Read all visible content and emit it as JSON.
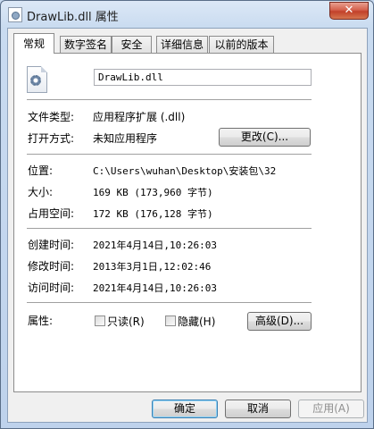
{
  "window": {
    "title": "DrawLib.dll 属性",
    "close_label": "✕"
  },
  "tabs": [
    {
      "label": "常规",
      "active": true
    },
    {
      "label": "数字签名",
      "active": false
    },
    {
      "label": "安全",
      "active": false
    },
    {
      "label": "详细信息",
      "active": false
    },
    {
      "label": "以前的版本",
      "active": false
    }
  ],
  "general": {
    "file_name": "DrawLib.dll",
    "file_type_label": "文件类型:",
    "file_type_value": "应用程序扩展 (.dll)",
    "open_with_label": "打开方式:",
    "open_with_value": "未知应用程序",
    "change_button": "更改(C)...",
    "location_label": "位置:",
    "location_value": "C:\\Users\\wuhan\\Desktop\\安装包\\32",
    "size_label": "大小:",
    "size_value": "169 KB (173,960 字节)",
    "size_on_disk_label": "占用空间:",
    "size_on_disk_value": "172 KB (176,128 字节)",
    "created_label": "创建时间:",
    "created_value": "2021年4月14日,10:26:03",
    "modified_label": "修改时间:",
    "modified_value": "2013年3月1日,12:02:46",
    "accessed_label": "访问时间:",
    "accessed_value": "2021年4月14日,10:26:03",
    "attributes_label": "属性:",
    "readonly_label": "只读(R)",
    "hidden_label": "隐藏(H)",
    "advanced_button": "高级(D)..."
  },
  "footer": {
    "ok": "确定",
    "cancel": "取消",
    "apply": "应用(A)"
  }
}
